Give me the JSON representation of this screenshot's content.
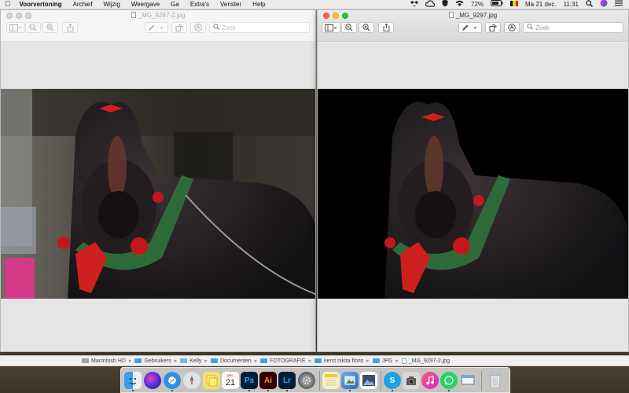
{
  "menubar": {
    "app_name": "Voorvertoning",
    "items": [
      "Archief",
      "Wijzig",
      "Weergave",
      "Ga",
      "Extra's",
      "Venster",
      "Help"
    ],
    "battery": "72%",
    "date": "Ma 21 dec.",
    "time": "11:31"
  },
  "window_left": {
    "title": "_MG_9297-2.jpg",
    "search_placeholder": "Zoek",
    "active": false
  },
  "window_right": {
    "title": "_MG_9297.jpg",
    "search_placeholder": "Zoek",
    "active": true
  },
  "pathbar": {
    "crumbs": [
      "Macintosh HD",
      "Gebruikers",
      "Kelly",
      "Documenten",
      "FOTOGRAFIE",
      "kerst nikita floris",
      "JPG",
      "_MG_9297-2.jpg"
    ]
  },
  "dock": {
    "calendar_day": "21",
    "calendar_month": "DEC",
    "photoshop_label": "Ps",
    "illustrator_label": "Ai",
    "lightroom_label": "Lr",
    "word_label": "W",
    "skype_label": "S"
  },
  "colors": {
    "close": "#fc5f57",
    "minimize": "#fdbc2e",
    "zoom": "#28c840",
    "folder": "#4a9fe0"
  }
}
